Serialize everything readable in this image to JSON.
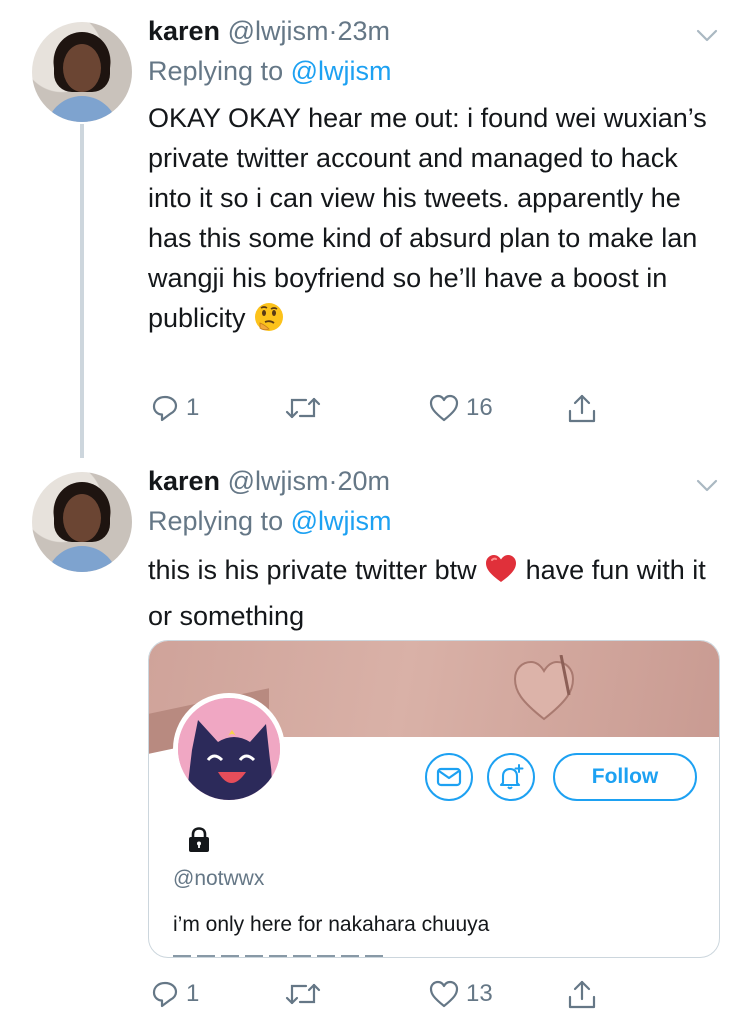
{
  "tweets": [
    {
      "name": "karen",
      "handle": "@lwjism",
      "separator": "·",
      "time": "23m",
      "reply_prefix": "Replying to",
      "reply_handle": "@lwjism",
      "text": "OKAY OKAY hear me out: i found wei wuxian’s private twitter account and managed to hack into it so i can view his tweets. apparently he has this some kind of absurd plan to make lan wangji his boyfriend so he’ll have a boost in publicity",
      "emoji": "thinking-face",
      "replies": "1",
      "retweets": "",
      "likes": "16"
    },
    {
      "name": "karen",
      "handle": "@lwjism",
      "separator": "·",
      "time": "20m",
      "reply_prefix": "Replying to",
      "reply_handle": "@lwjism",
      "text_before_emoji": "this is his private twitter btw",
      "emoji": "red-heart",
      "text_after_emoji": "have fun with it or something",
      "replies": "1",
      "retweets": "",
      "likes": "13"
    }
  ],
  "profile_card": {
    "follow_label": "Follow",
    "handle": "@notwwx",
    "bio": "i’m only here for nakahara chuuya",
    "locked": true
  },
  "colors": {
    "accent": "#1da1f2",
    "muted": "#657786",
    "text": "#14171a",
    "heart_red": "#e0245e"
  }
}
